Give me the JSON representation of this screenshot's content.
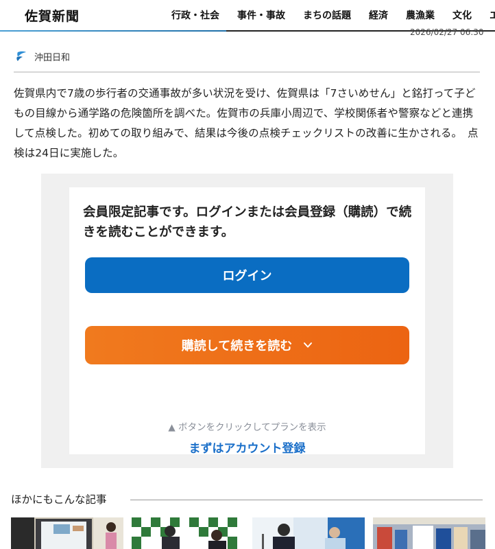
{
  "header": {
    "logo": "佐賀新聞",
    "nav": [
      "行政・社会",
      "事件・事故",
      "まちの話題",
      "経済",
      "農漁業",
      "文化",
      "エ"
    ]
  },
  "article": {
    "timestamp": "2026/02/27 06:30",
    "source": "沖田日和",
    "body": "佐賀県内で7歳の歩行者の交通事故が多い状況を受け、佐賀県は「7さいめせん」と銘打って子どもの目線から通学路の危険箇所を調べた。佐賀市の兵庫小周辺で、学校関係者や警察などと連携して点検した。初めての取り組みで、結果は今後の点検チェックリストの改善に生かされる。　点検は24日に実施した。"
  },
  "paywall": {
    "message": "会員限定記事です。ログインまたは会員登録（購読）で続きを読むことができます。",
    "login_label": "ログイン",
    "subscribe_label": "購読して続きを読む",
    "plan_hint": "▲ ボタンをクリックしてプランを表示",
    "account_link": "まずはアカウント登録"
  },
  "related": {
    "heading": "ほかにもこんな記事"
  },
  "colors": {
    "login": "#0a6dc2",
    "subscribe": "#ec6412",
    "link": "#1a6fc9",
    "accent": "#4a9fd4"
  }
}
